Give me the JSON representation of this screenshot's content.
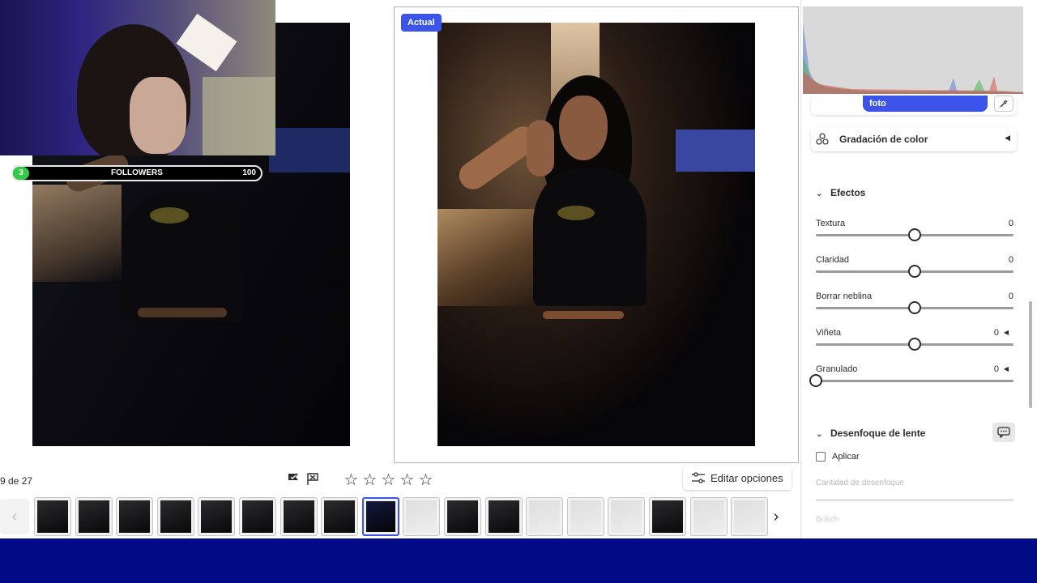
{
  "compare": {
    "current_badge": "Actual"
  },
  "stream_overlay": {
    "followers_count": "3",
    "followers_label": "FOLLOWERS",
    "followers_goal": "100",
    "progress_fraction": 0.03
  },
  "panel": {
    "profile_label": "foto",
    "color_grading_title": "Gradación de color",
    "effects_title": "Efectos",
    "sliders": [
      {
        "label": "Textura",
        "value": "0",
        "has_caret": false,
        "level": 0.5
      },
      {
        "label": "Claridad",
        "value": "0",
        "has_caret": false,
        "level": 0.5
      },
      {
        "label": "Borrar neblina",
        "value": "0",
        "has_caret": false,
        "level": 0.5
      },
      {
        "label": "Viñeta",
        "value": "0",
        "has_caret": true,
        "level": 0.5
      },
      {
        "label": "Granulado",
        "value": "0",
        "has_caret": true,
        "level": 0.0
      }
    ],
    "lens_blur_title": "Desenfoque de lente",
    "apply_label": "Aplicar",
    "blur_amount_label": "Cantidad de desenfoque",
    "bokeh_label": "Bokeh"
  },
  "toolbar": {
    "counter": "9 de 27",
    "edit_options_label": "Editar opciones",
    "rating_stars": 0
  },
  "filmstrip": {
    "selected_index": 8,
    "thumbnails": [
      "dark",
      "dark",
      "dark",
      "dark",
      "dark",
      "dark",
      "dark",
      "dark",
      "selected",
      "light",
      "dark",
      "dark",
      "light",
      "light",
      "light",
      "dark",
      "light",
      "light"
    ]
  },
  "colors": {
    "accent": "#3d54ea",
    "bottom_band": "#020a86",
    "progress_dot": "#35c94a"
  }
}
